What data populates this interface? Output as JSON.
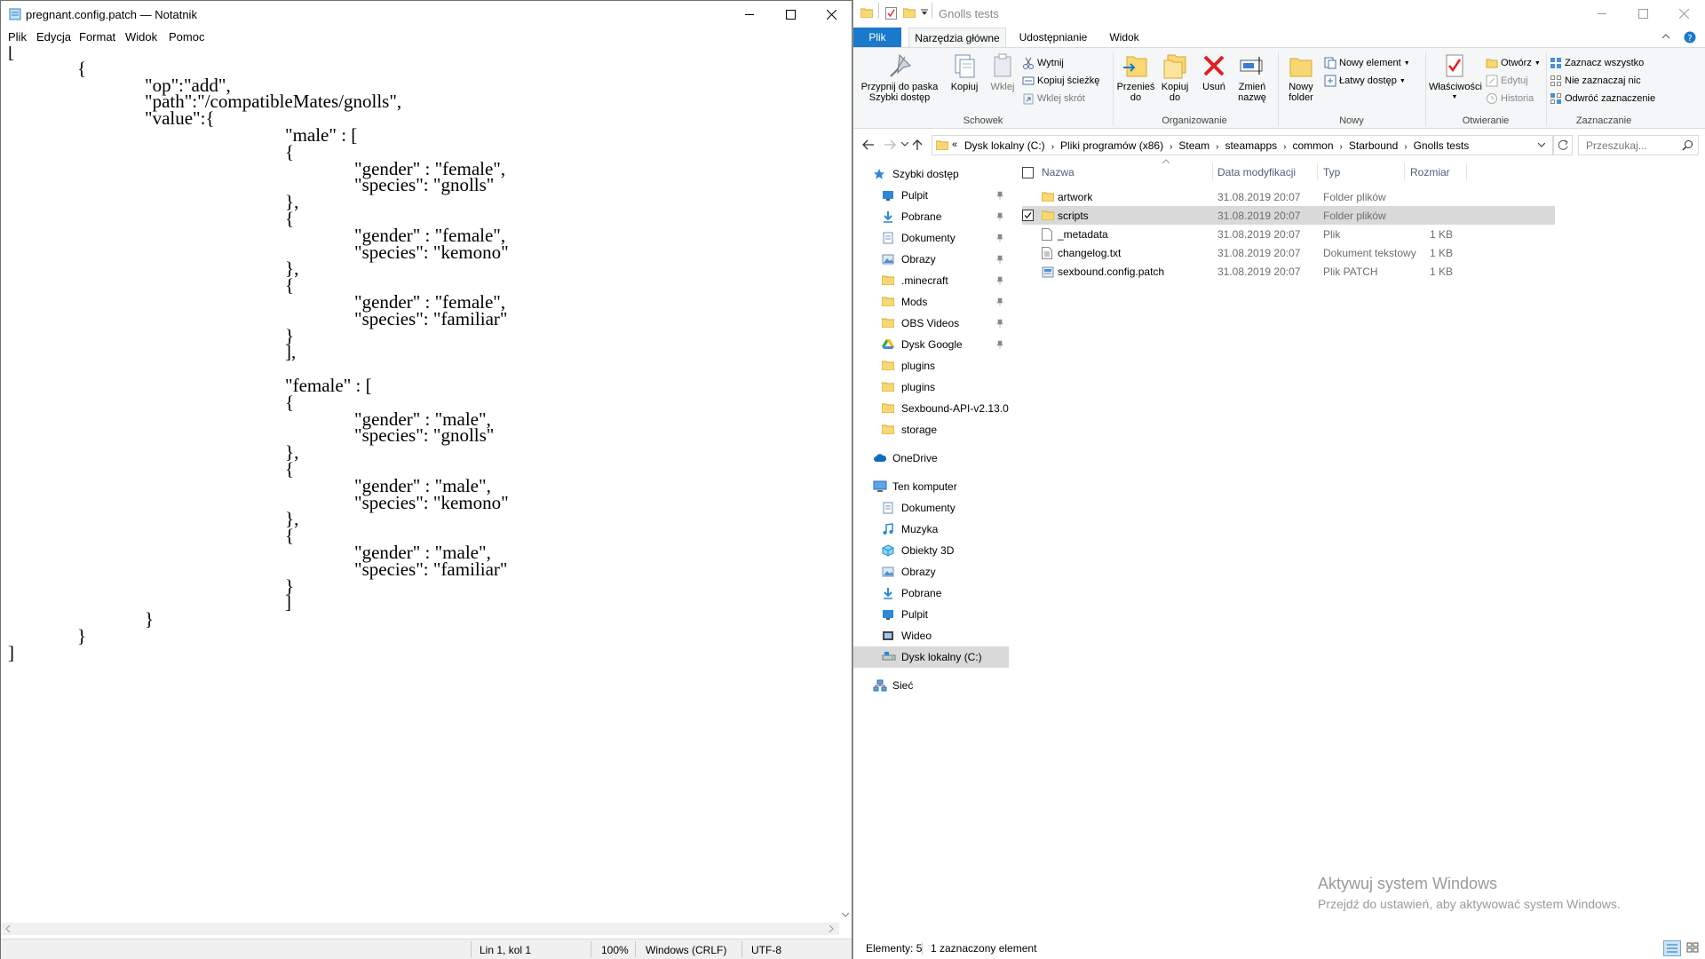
{
  "notepad": {
    "title": "pregnant.config.patch — Notatnik",
    "menu": [
      "Plik",
      "Edycja",
      "Format",
      "Widok",
      "Pomoc"
    ],
    "lines": [
      "[",
      "{",
      "\"op\":\"add\",",
      "\"path\":\"/compatibleMates/gnolls\",",
      "\"value\":{",
      "\"male\" : [",
      "{",
      "\"gender\" : \"female\",",
      "\"species\": \"gnolls\"",
      "},",
      "{",
      "\"gender\" : \"female\",",
      "\"species\": \"kemono\"",
      "},",
      "{",
      "\"gender\" : \"female\",",
      "\"species\": \"familiar\"",
      "}",
      "],",
      "",
      "\"female\" : [",
      "{",
      "\"gender\" : \"male\",",
      "\"species\": \"gnolls\"",
      "},",
      "{",
      "\"gender\" : \"male\",",
      "\"species\": \"kemono\"",
      "},",
      "{",
      "\"gender\" : \"male\",",
      "\"species\": \"familiar\"",
      "}",
      "]",
      "}",
      "}",
      "]"
    ],
    "status": {
      "position": "Lin 1, kol 1",
      "zoom": "100%",
      "line_ending": "Windows (CRLF)",
      "encoding": "UTF-8"
    }
  },
  "explorer": {
    "title": "Gnolls tests",
    "tabs": [
      "Plik",
      "Narzędzia główne",
      "Udostępnianie",
      "Widok"
    ],
    "ribbon": {
      "pin": "Przypnij do paska Szybki dostęp",
      "copy": "Kopiuj",
      "paste": "Wklej",
      "cut": "Wytnij",
      "copy_path": "Kopiuj ścieżkę",
      "paste_shortcut": "Wklej skrót",
      "group_clipboard": "Schowek",
      "move_to": "Przenieś do",
      "copy_to": "Kopiuj do",
      "delete": "Usuń",
      "rename": "Zmień nazwę",
      "group_organize": "Organizowanie",
      "new_folder": "Nowy folder",
      "new_item": "Nowy element",
      "easy_access": "Łatwy dostęp",
      "group_new": "Nowy",
      "properties": "Właściwości",
      "open": "Otwórz",
      "edit": "Edytuj",
      "history": "Historia",
      "group_open": "Otwieranie",
      "select_all": "Zaznacz wszystko",
      "select_none": "Nie zaznaczaj nic",
      "invert": "Odwróć zaznaczenie",
      "group_select": "Zaznaczanie"
    },
    "address": [
      "Dysk lokalny (C:)",
      "Pliki programów (x86)",
      "Steam",
      "steamapps",
      "common",
      "Starbound",
      "Gnolls tests"
    ],
    "search_placeholder": "Przeszukaj...",
    "nav": [
      {
        "label": "Szybki dostęp",
        "icon": "star-icon"
      },
      {
        "label": "Pulpit",
        "icon": "desktop-icon",
        "pin": true
      },
      {
        "label": "Pobrane",
        "icon": "download-icon",
        "pin": true
      },
      {
        "label": "Dokumenty",
        "icon": "documents-icon",
        "pin": true
      },
      {
        "label": "Obrazy",
        "icon": "pictures-icon",
        "pin": true
      },
      {
        "label": ".minecraft",
        "icon": "folder-icon",
        "pin": true
      },
      {
        "label": "Mods",
        "icon": "folder-icon",
        "pin": true
      },
      {
        "label": "OBS Videos",
        "icon": "folder-icon",
        "pin": true
      },
      {
        "label": "Dysk Google",
        "icon": "google-drive-icon",
        "pin": true
      },
      {
        "label": "plugins",
        "icon": "folder-icon"
      },
      {
        "label": "plugins",
        "icon": "folder-icon"
      },
      {
        "label": "Sexbound-API-v2.13.0",
        "icon": "folder-icon"
      },
      {
        "label": "storage",
        "icon": "folder-icon"
      },
      {
        "label": "OneDrive",
        "icon": "cloud-icon"
      },
      {
        "label": "Ten komputer",
        "icon": "computer-icon"
      },
      {
        "label": "Dokumenty",
        "icon": "documents-icon"
      },
      {
        "label": "Muzyka",
        "icon": "music-icon"
      },
      {
        "label": "Obiekty 3D",
        "icon": "cube-icon"
      },
      {
        "label": "Obrazy",
        "icon": "pictures-icon"
      },
      {
        "label": "Pobrane",
        "icon": "download-icon"
      },
      {
        "label": "Pulpit",
        "icon": "desktop-icon"
      },
      {
        "label": "Wideo",
        "icon": "video-icon"
      },
      {
        "label": "Dysk lokalny (C:)",
        "icon": "drive-icon"
      },
      {
        "label": "Sieć",
        "icon": "network-icon"
      }
    ],
    "columns": [
      "Nazwa",
      "Data modyfikacji",
      "Typ",
      "Rozmiar"
    ],
    "files": [
      {
        "name": "artwork",
        "date": "31.08.2019 20:07",
        "type": "Folder plików",
        "size": "",
        "icon": "folder-icon"
      },
      {
        "name": "scripts",
        "date": "31.08.2019 20:07",
        "type": "Folder plików",
        "size": "",
        "icon": "folder-icon",
        "selected": true
      },
      {
        "name": "_metadata",
        "date": "31.08.2019 20:07",
        "type": "Plik",
        "size": "1 KB",
        "icon": "file-icon"
      },
      {
        "name": "changelog.txt",
        "date": "31.08.2019 20:07",
        "type": "Dokument tekstowy",
        "size": "1 KB",
        "icon": "text-file-icon"
      },
      {
        "name": "sexbound.config.patch",
        "date": "31.08.2019 20:07",
        "type": "Plik PATCH",
        "size": "1 KB",
        "icon": "patch-file-icon"
      }
    ],
    "status_count": "Elementy: 5",
    "status_selected": "1 zaznaczony element",
    "watermark_title": "Aktywuj system Windows",
    "watermark_sub": "Przejdź do ustawień, aby aktywować system Windows.",
    "colors": {
      "accent": "#1979ca",
      "selected_row": "#d9d9d9",
      "folder": "#f8d775"
    }
  }
}
